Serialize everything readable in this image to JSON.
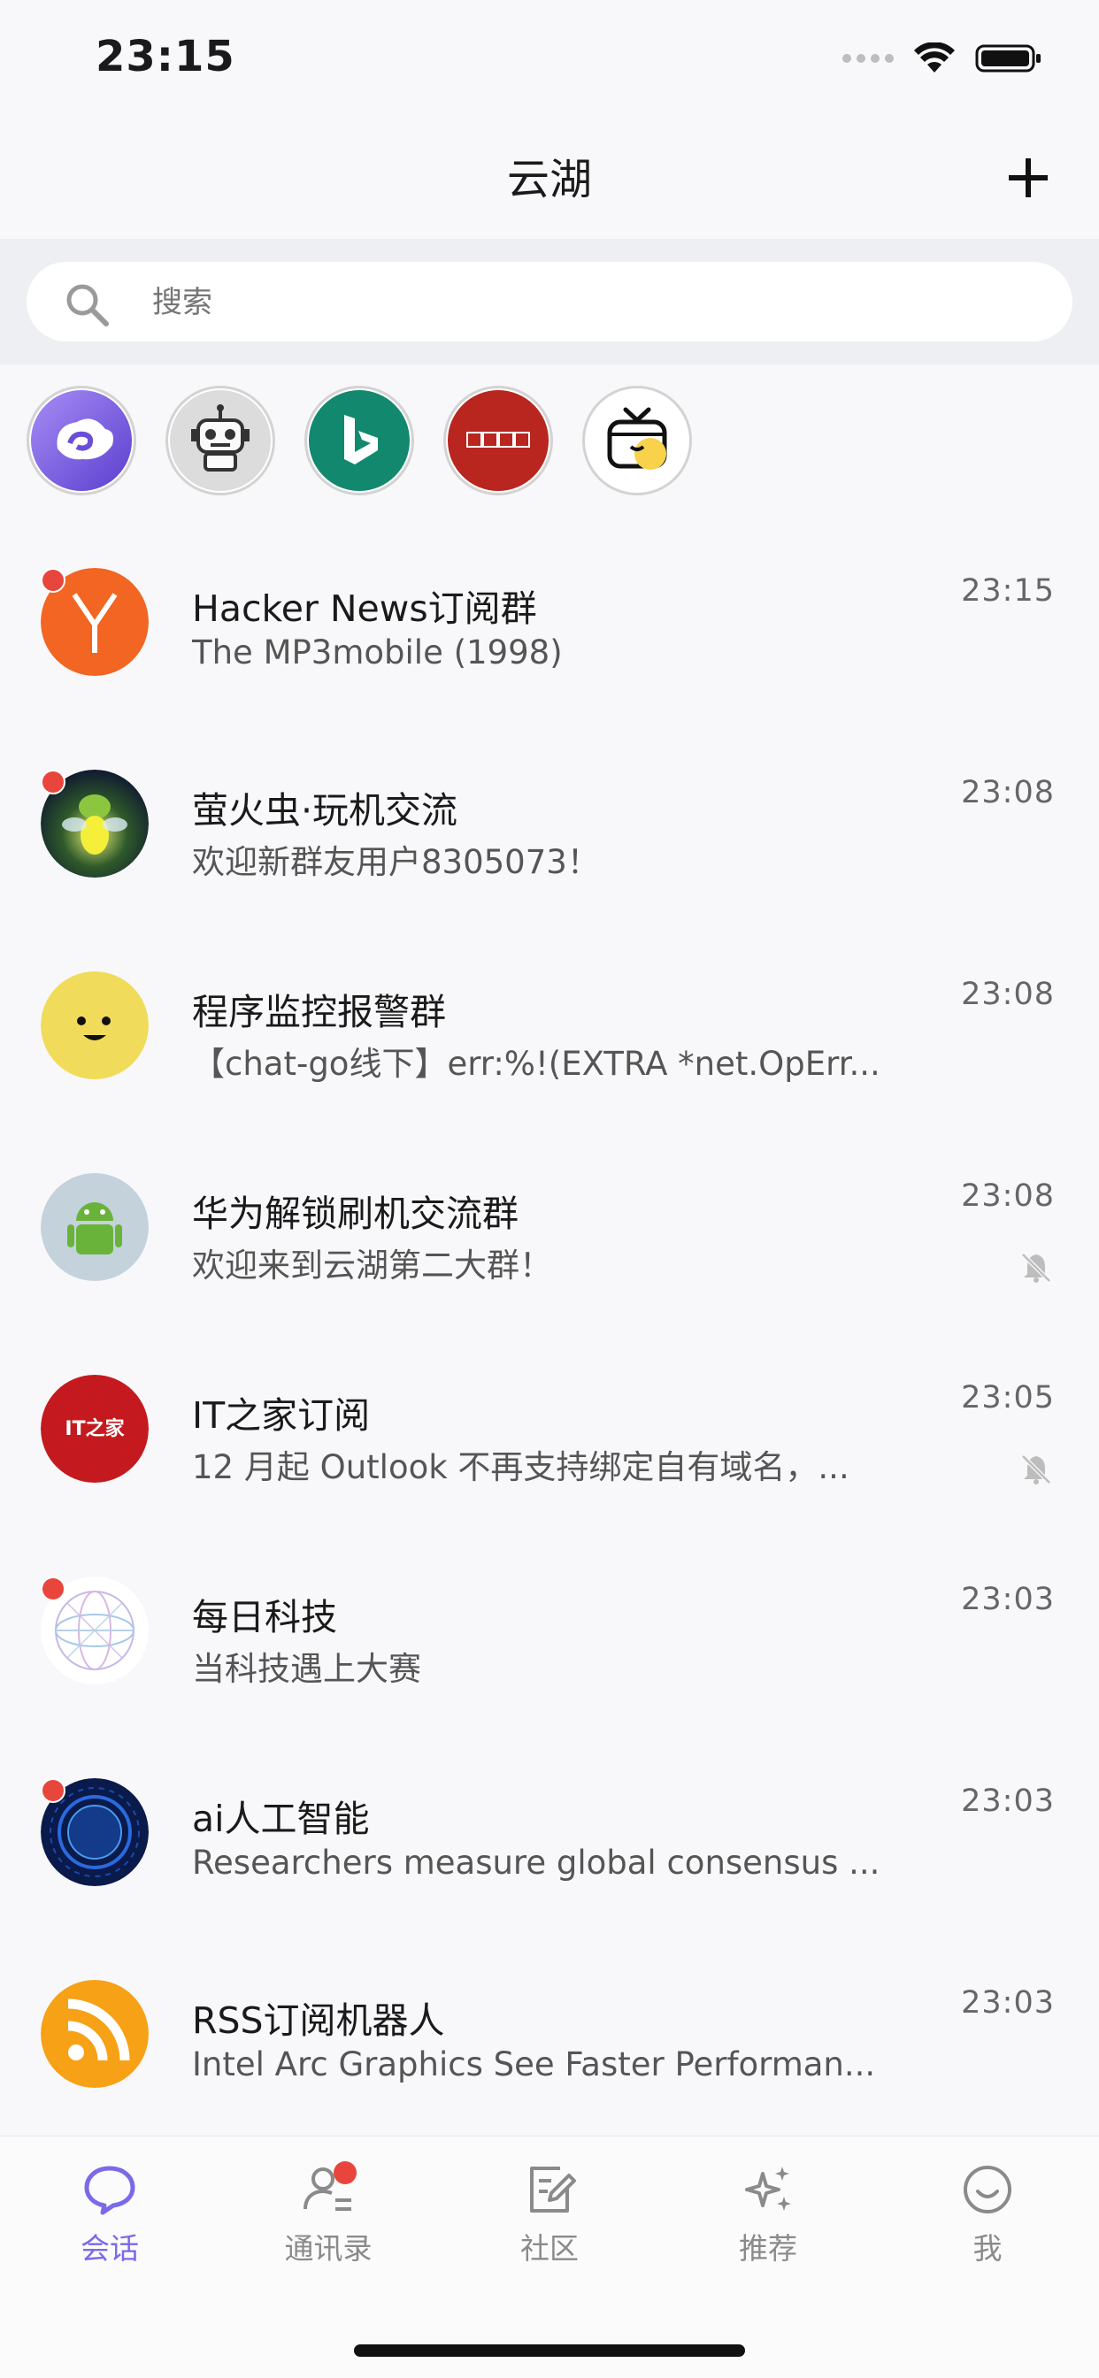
{
  "status_bar": {
    "time": "23:15"
  },
  "header": {
    "title": "云湖"
  },
  "search": {
    "placeholder": "搜索"
  },
  "shortcuts": [
    {
      "icon": "yunhu-cloud-icon"
    },
    {
      "icon": "robot-icon"
    },
    {
      "icon": "bing-icon"
    },
    {
      "icon": "free-movie-icon"
    },
    {
      "icon": "tv-icon"
    }
  ],
  "chats": [
    {
      "name": "Hacker News订阅群",
      "preview": "The MP3mobile (1998)",
      "time": "23:15",
      "unread": true,
      "muted": false
    },
    {
      "name": "萤火虫·玩机交流",
      "preview": "欢迎新群友用户8305073！",
      "time": "23:08",
      "unread": true,
      "muted": false
    },
    {
      "name": "程序监控报警群",
      "preview": "【chat-go线下】err:%!(EXTRA *net.OpErr...",
      "time": "23:08",
      "unread": false,
      "muted": false
    },
    {
      "name": "华为解锁刷机交流群",
      "preview": "欢迎来到云湖第二大群！",
      "time": "23:08",
      "unread": false,
      "muted": true
    },
    {
      "name": "IT之家订阅",
      "preview": "12 月起 Outlook 不再支持绑定自有域名，...",
      "time": "23:05",
      "unread": false,
      "muted": true
    },
    {
      "name": "每日科技",
      "preview": "当科技遇上大赛",
      "time": "23:03",
      "unread": true,
      "muted": false
    },
    {
      "name": "ai人工智能",
      "preview": "Researchers measure global consensus ...",
      "time": "23:03",
      "unread": true,
      "muted": false
    },
    {
      "name": "RSS订阅机器人",
      "preview": "Intel Arc Graphics See Faster Performan...",
      "time": "23:03",
      "unread": false,
      "muted": false
    }
  ],
  "avatar_labels": {
    "it_home": "IT之家"
  },
  "tabs": [
    {
      "label": "会话",
      "active": true
    },
    {
      "label": "通讯录",
      "active": false,
      "badge": true
    },
    {
      "label": "社区",
      "active": false
    },
    {
      "label": "推荐",
      "active": false
    },
    {
      "label": "我",
      "active": false
    }
  ],
  "colors": {
    "accent": "#7a6ae8",
    "unread_badge": "#e8463d",
    "hn_orange": "#f26522",
    "rss_orange": "#f7a116"
  }
}
